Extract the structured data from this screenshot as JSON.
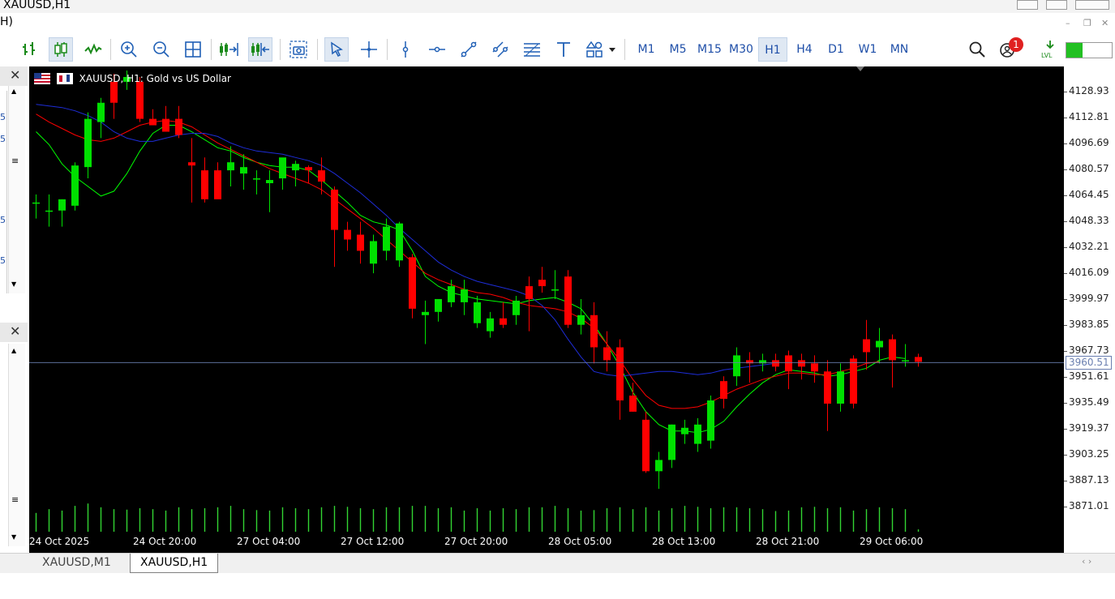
{
  "window": {
    "title": "XAUUSD,H1",
    "menu_fragment": "H)"
  },
  "toolbar": {
    "timeframes": [
      "M1",
      "M5",
      "M15",
      "M30",
      "H1",
      "H4",
      "D1",
      "W1",
      "MN"
    ],
    "active_timeframe": "H1",
    "notification_count": "1",
    "level_label": "LVL"
  },
  "chart": {
    "symbol_label": "XAUUSD, H1:  Gold vs US Dollar",
    "price_labels": [
      "4128.93",
      "4112.81",
      "4096.69",
      "4080.57",
      "4064.45",
      "4048.33",
      "4032.21",
      "4016.09",
      "3999.97",
      "3983.85",
      "3967.73",
      "3951.61",
      "3935.49",
      "3919.37",
      "3903.25",
      "3887.13",
      "3871.01"
    ],
    "current_price": "3960.51",
    "time_labels": [
      "24 Oct 2025",
      "24 Oct 20:00",
      "27 Oct 04:00",
      "27 Oct 12:00",
      "27 Oct 20:00",
      "28 Oct 05:00",
      "28 Oct 13:00",
      "28 Oct 21:00",
      "29 Oct 06:00"
    ]
  },
  "chart_data": {
    "type": "candlestick",
    "symbol": "XAUUSD",
    "timeframe": "H1",
    "y_axis_range": [
      3871.01,
      4128.93
    ],
    "current_price": 3960.51,
    "candles": [
      {
        "o": 4060,
        "h": 4065,
        "l": 4050,
        "c": 4060
      },
      {
        "o": 4055,
        "h": 4065,
        "l": 4045,
        "c": 4055
      },
      {
        "o": 4055,
        "h": 4062,
        "l": 4045,
        "c": 4062
      },
      {
        "o": 4058,
        "h": 4085,
        "l": 4055,
        "c": 4083
      },
      {
        "o": 4082,
        "h": 4116,
        "l": 4075,
        "c": 4112
      },
      {
        "o": 4110,
        "h": 4125,
        "l": 4100,
        "c": 4122
      },
      {
        "o": 4135,
        "h": 4140,
        "l": 4112,
        "c": 4122
      },
      {
        "o": 4135,
        "h": 4142,
        "l": 4130,
        "c": 4138
      },
      {
        "o": 4135,
        "h": 4138,
        "l": 4110,
        "c": 4112
      },
      {
        "o": 4112,
        "h": 4118,
        "l": 4108,
        "c": 4108
      },
      {
        "o": 4112,
        "h": 4120,
        "l": 4104,
        "c": 4104
      },
      {
        "o": 4112,
        "h": 4120,
        "l": 4100,
        "c": 4102
      },
      {
        "o": 4085,
        "h": 4100,
        "l": 4060,
        "c": 4083
      },
      {
        "o": 4080,
        "h": 4088,
        "l": 4060,
        "c": 4062
      },
      {
        "o": 4080,
        "h": 4085,
        "l": 4065,
        "c": 4062
      },
      {
        "o": 4080,
        "h": 4095,
        "l": 4070,
        "c": 4085
      },
      {
        "o": 4078,
        "h": 4090,
        "l": 4068,
        "c": 4082
      },
      {
        "o": 4075,
        "h": 4080,
        "l": 4065,
        "c": 4075
      },
      {
        "o": 4072,
        "h": 4080,
        "l": 4054,
        "c": 4074
      },
      {
        "o": 4075,
        "h": 4085,
        "l": 4068,
        "c": 4088
      },
      {
        "o": 4080,
        "h": 4086,
        "l": 4070,
        "c": 4084
      },
      {
        "o": 4082,
        "h": 4083,
        "l": 4072,
        "c": 4080
      },
      {
        "o": 4080,
        "h": 4088,
        "l": 4065,
        "c": 4073
      },
      {
        "o": 4068,
        "h": 4070,
        "l": 4020,
        "c": 4043
      },
      {
        "o": 4043,
        "h": 4048,
        "l": 4030,
        "c": 4037
      },
      {
        "o": 4040,
        "h": 4048,
        "l": 4022,
        "c": 4030
      },
      {
        "o": 4022,
        "h": 4040,
        "l": 4016,
        "c": 4036
      },
      {
        "o": 4030,
        "h": 4050,
        "l": 4024,
        "c": 4045
      },
      {
        "o": 4024,
        "h": 4048,
        "l": 4020,
        "c": 4047
      },
      {
        "o": 4026,
        "h": 4028,
        "l": 3988,
        "c": 3994
      },
      {
        "o": 3990,
        "h": 3999,
        "l": 3972,
        "c": 3992
      },
      {
        "o": 3992,
        "h": 4000,
        "l": 3986,
        "c": 4000
      },
      {
        "o": 3998,
        "h": 4012,
        "l": 3995,
        "c": 4008
      },
      {
        "o": 3998,
        "h": 4012,
        "l": 3990,
        "c": 4006
      },
      {
        "o": 3985,
        "h": 4002,
        "l": 3982,
        "c": 3998
      },
      {
        "o": 3980,
        "h": 3992,
        "l": 3976,
        "c": 3988
      },
      {
        "o": 3988,
        "h": 3998,
        "l": 3982,
        "c": 3984
      },
      {
        "o": 3990,
        "h": 4002,
        "l": 3984,
        "c": 3999
      },
      {
        "o": 4008,
        "h": 4014,
        "l": 3980,
        "c": 4000
      },
      {
        "o": 4012,
        "h": 4020,
        "l": 4004,
        "c": 4008
      },
      {
        "o": 4006,
        "h": 4018,
        "l": 4000,
        "c": 4006
      },
      {
        "o": 4014,
        "h": 4018,
        "l": 3982,
        "c": 3984
      },
      {
        "o": 3984,
        "h": 4000,
        "l": 3978,
        "c": 3990
      },
      {
        "o": 3990,
        "h": 3998,
        "l": 3960,
        "c": 3970
      },
      {
        "o": 3970,
        "h": 3980,
        "l": 3955,
        "c": 3962
      },
      {
        "o": 3970,
        "h": 3975,
        "l": 3925,
        "c": 3937
      },
      {
        "o": 3940,
        "h": 3948,
        "l": 3930,
        "c": 3930
      },
      {
        "o": 3925,
        "h": 3930,
        "l": 3892,
        "c": 3893
      },
      {
        "o": 3893,
        "h": 3905,
        "l": 3882,
        "c": 3900
      },
      {
        "o": 3900,
        "h": 3922,
        "l": 3895,
        "c": 3922
      },
      {
        "o": 3916,
        "h": 3925,
        "l": 3910,
        "c": 3920
      },
      {
        "o": 3910,
        "h": 3926,
        "l": 3905,
        "c": 3922
      },
      {
        "o": 3912,
        "h": 3940,
        "l": 3907,
        "c": 3937
      },
      {
        "o": 3949,
        "h": 3952,
        "l": 3932,
        "c": 3938
      },
      {
        "o": 3952,
        "h": 3970,
        "l": 3946,
        "c": 3965
      },
      {
        "o": 3962,
        "h": 3967,
        "l": 3948,
        "c": 3960
      },
      {
        "o": 3960,
        "h": 3966,
        "l": 3955,
        "c": 3962
      },
      {
        "o": 3962,
        "h": 3966,
        "l": 3955,
        "c": 3958
      },
      {
        "o": 3965,
        "h": 3968,
        "l": 3944,
        "c": 3955
      },
      {
        "o": 3962,
        "h": 3966,
        "l": 3950,
        "c": 3958
      },
      {
        "o": 3960,
        "h": 3965,
        "l": 3948,
        "c": 3955
      },
      {
        "o": 3955,
        "h": 3962,
        "l": 3918,
        "c": 3935
      },
      {
        "o": 3935,
        "h": 3960,
        "l": 3930,
        "c": 3955
      },
      {
        "o": 3963,
        "h": 3965,
        "l": 3932,
        "c": 3935
      },
      {
        "o": 3975,
        "h": 3987,
        "l": 3956,
        "c": 3967
      },
      {
        "o": 3970,
        "h": 3982,
        "l": 3960,
        "c": 3974
      },
      {
        "o": 3975,
        "h": 3978,
        "l": 3945,
        "c": 3962
      },
      {
        "o": 3962,
        "h": 3972,
        "l": 3958,
        "c": 3962
      },
      {
        "o": 3964,
        "h": 3966,
        "l": 3958,
        "c": 3961
      }
    ],
    "moving_averages": [
      {
        "color": "#00ff00",
        "values": [
          4104,
          4096,
          4084,
          4076,
          4070,
          4064,
          4067,
          4078,
          4092,
          4103,
          4108,
          4108,
          4104,
          4099,
          4094,
          4092,
          4088,
          4085,
          4083,
          4082,
          4082,
          4080,
          4074,
          4067,
          4060,
          4052,
          4048,
          4046,
          4043,
          4030,
          4014,
          4008,
          4004,
          4002,
          4000,
          3999,
          3998,
          3997,
          3999,
          4000,
          4001,
          3998,
          3994,
          3984,
          3972,
          3958,
          3942,
          3930,
          3922,
          3918,
          3918,
          3917,
          3919,
          3924,
          3933,
          3941,
          3948,
          3953,
          3956,
          3955,
          3954,
          3952,
          3953,
          3955,
          3957,
          3962,
          3964,
          3963
        ]
      },
      {
        "color": "#ff0000",
        "values": [
          4115,
          4110,
          4106,
          4102,
          4099,
          4098,
          4100,
          4104,
          4108,
          4110,
          4111,
          4110,
          4107,
          4102,
          4097,
          4093,
          4089,
          4085,
          4081,
          4078,
          4075,
          4072,
          4068,
          4062,
          4056,
          4050,
          4044,
          4037,
          4030,
          4023,
          4016,
          4012,
          4009,
          4006,
          4004,
          4003,
          4001,
          3998,
          3996,
          3995,
          3994,
          3992,
          3988,
          3982,
          3972,
          3962,
          3950,
          3940,
          3934,
          3932,
          3932,
          3933,
          3936,
          3940,
          3944,
          3947,
          3950,
          3952,
          3954,
          3954,
          3953,
          3953,
          3955,
          3957,
          3960,
          3961
        ]
      },
      {
        "color": "#1e2dd8",
        "values": [
          4121,
          4120,
          4119,
          4117,
          4114,
          4110,
          4104,
          4100,
          4098,
          4098,
          4100,
          4102,
          4103,
          4103,
          4101,
          4097,
          4094,
          4092,
          4091,
          4090,
          4088,
          4086,
          4083,
          4078,
          4072,
          4066,
          4059,
          4052,
          4044,
          4037,
          4030,
          4023,
          4018,
          4014,
          4011,
          4009,
          4007,
          4005,
          4002,
          3996,
          3987,
          3975,
          3964,
          3955,
          3953,
          3952,
          3953,
          3954,
          3955,
          3955,
          3954,
          3953,
          3954,
          3956,
          3957,
          3958,
          3959,
          3960
        ]
      }
    ],
    "volumes": [
      40,
      48,
      45,
      55,
      60,
      52,
      48,
      47,
      50,
      48,
      45,
      52,
      48,
      50,
      52,
      55,
      48,
      46,
      45,
      52,
      50,
      48,
      52,
      55,
      53,
      50,
      48,
      52,
      52,
      55,
      55,
      50,
      52,
      45,
      50,
      45,
      50,
      48,
      52,
      52,
      55,
      50,
      45,
      46,
      50,
      52,
      48,
      52,
      45,
      50,
      55,
      53,
      50,
      52,
      52,
      50,
      48,
      44,
      45,
      52,
      53,
      50,
      52,
      45,
      48,
      52,
      50,
      48,
      5
    ]
  }
}
